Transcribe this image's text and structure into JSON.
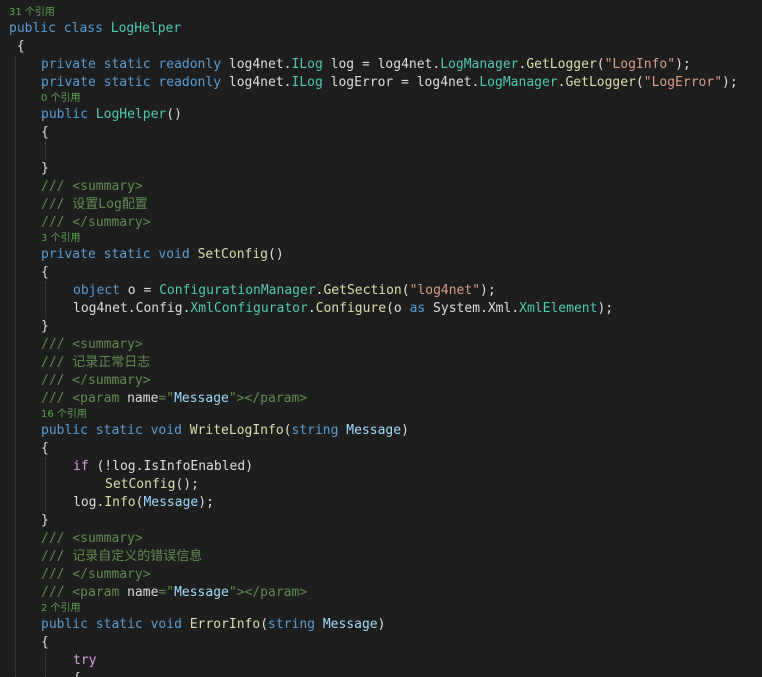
{
  "editor": {
    "colors": {
      "background": "#1e1e1e",
      "keyword": "#569cd6",
      "control_keyword": "#d8a0df",
      "type": "#4ec9b0",
      "method": "#dcdcaa",
      "string": "#d69d85",
      "comment": "#57a64a",
      "parameter": "#9cdcfe",
      "text": "#dcdcdc",
      "codelens": "#9a9a9a"
    },
    "lines": [
      {
        "kind": "lens",
        "indent": 0,
        "tokens": [
          [
            "c",
            "31 个引用"
          ]
        ]
      },
      {
        "kind": "code",
        "indent": 0,
        "tokens": [
          [
            "k",
            "public"
          ],
          [
            "p",
            " "
          ],
          [
            "k",
            "class"
          ],
          [
            "p",
            " "
          ],
          [
            "t",
            "LogHelper"
          ]
        ]
      },
      {
        "kind": "code",
        "indent": 0,
        "tokens": [
          [
            "p",
            " {"
          ]
        ]
      },
      {
        "kind": "code",
        "indent": 1,
        "tokens": [
          [
            "k",
            "private"
          ],
          [
            "p",
            " "
          ],
          [
            "k",
            "static"
          ],
          [
            "p",
            " "
          ],
          [
            "k",
            "readonly"
          ],
          [
            "p",
            " log4net."
          ],
          [
            "t",
            "ILog"
          ],
          [
            "p",
            " log = log4net."
          ],
          [
            "t",
            "LogManager"
          ],
          [
            "p",
            "."
          ],
          [
            "m",
            "GetLogger"
          ],
          [
            "p",
            "("
          ],
          [
            "s",
            "\"LogInfo\""
          ],
          [
            "p",
            ");"
          ]
        ]
      },
      {
        "kind": "code",
        "indent": 1,
        "tokens": [
          [
            "k",
            "private"
          ],
          [
            "p",
            " "
          ],
          [
            "k",
            "static"
          ],
          [
            "p",
            " "
          ],
          [
            "k",
            "readonly"
          ],
          [
            "p",
            " log4net."
          ],
          [
            "t",
            "ILog"
          ],
          [
            "p",
            " logError = log4net."
          ],
          [
            "t",
            "LogManager"
          ],
          [
            "p",
            "."
          ],
          [
            "m",
            "GetLogger"
          ],
          [
            "p",
            "("
          ],
          [
            "s",
            "\"LogError\""
          ],
          [
            "p",
            ");"
          ]
        ]
      },
      {
        "kind": "lens",
        "indent": 1,
        "tokens": [
          [
            "c",
            "0 个引用"
          ]
        ]
      },
      {
        "kind": "code",
        "indent": 1,
        "tokens": [
          [
            "k",
            "public"
          ],
          [
            "p",
            " "
          ],
          [
            "t",
            "LogHelper"
          ],
          [
            "p",
            "()"
          ]
        ]
      },
      {
        "kind": "code",
        "indent": 1,
        "tokens": [
          [
            "p",
            "{"
          ]
        ]
      },
      {
        "kind": "code",
        "indent": 1,
        "tokens": []
      },
      {
        "kind": "code",
        "indent": 1,
        "tokens": [
          [
            "p",
            "}"
          ]
        ]
      },
      {
        "kind": "code",
        "indent": 1,
        "tokens": [
          [
            "g",
            "/// <summary>"
          ]
        ]
      },
      {
        "kind": "code",
        "indent": 1,
        "tokens": [
          [
            "g",
            "/// 设置Log配置"
          ]
        ]
      },
      {
        "kind": "code",
        "indent": 1,
        "tokens": [
          [
            "g",
            "/// </summary>"
          ]
        ]
      },
      {
        "kind": "lens",
        "indent": 1,
        "tokens": [
          [
            "c",
            "3 个引用"
          ]
        ]
      },
      {
        "kind": "code",
        "indent": 1,
        "tokens": [
          [
            "k",
            "private"
          ],
          [
            "p",
            " "
          ],
          [
            "k",
            "static"
          ],
          [
            "p",
            " "
          ],
          [
            "k",
            "void"
          ],
          [
            "p",
            " "
          ],
          [
            "m",
            "SetConfig"
          ],
          [
            "p",
            "()"
          ]
        ]
      },
      {
        "kind": "code",
        "indent": 1,
        "tokens": [
          [
            "p",
            "{"
          ]
        ]
      },
      {
        "kind": "code",
        "indent": 2,
        "tokens": [
          [
            "k",
            "object"
          ],
          [
            "p",
            " o = "
          ],
          [
            "t",
            "ConfigurationManager"
          ],
          [
            "p",
            "."
          ],
          [
            "m",
            "GetSection"
          ],
          [
            "p",
            "("
          ],
          [
            "s",
            "\"log4net\""
          ],
          [
            "p",
            ");"
          ]
        ]
      },
      {
        "kind": "code",
        "indent": 2,
        "tokens": [
          [
            "p",
            "log4net.Config."
          ],
          [
            "t",
            "XmlConfigurator"
          ],
          [
            "p",
            "."
          ],
          [
            "m",
            "Configure"
          ],
          [
            "p",
            "(o "
          ],
          [
            "k",
            "as"
          ],
          [
            "p",
            " System.Xml."
          ],
          [
            "t",
            "XmlElement"
          ],
          [
            "p",
            ");"
          ]
        ]
      },
      {
        "kind": "code",
        "indent": 1,
        "tokens": [
          [
            "p",
            "}"
          ]
        ]
      },
      {
        "kind": "code",
        "indent": 1,
        "tokens": [
          [
            "g",
            "/// <summary>"
          ]
        ]
      },
      {
        "kind": "code",
        "indent": 1,
        "tokens": [
          [
            "g",
            "/// 记录正常日志"
          ]
        ]
      },
      {
        "kind": "code",
        "indent": 1,
        "tokens": [
          [
            "g",
            "/// </summary>"
          ]
        ]
      },
      {
        "kind": "code",
        "indent": 1,
        "tokens": [
          [
            "g",
            "/// <param "
          ],
          [
            "p",
            "name"
          ],
          [
            "g",
            "=\""
          ],
          [
            "a",
            "Message"
          ],
          [
            "g",
            "\"></param>"
          ]
        ]
      },
      {
        "kind": "lens",
        "indent": 1,
        "tokens": [
          [
            "c",
            "16 个引用"
          ]
        ]
      },
      {
        "kind": "code",
        "indent": 1,
        "tokens": [
          [
            "k",
            "public"
          ],
          [
            "p",
            " "
          ],
          [
            "k",
            "static"
          ],
          [
            "p",
            " "
          ],
          [
            "k",
            "void"
          ],
          [
            "p",
            " "
          ],
          [
            "m",
            "WriteLogInfo"
          ],
          [
            "p",
            "("
          ],
          [
            "k",
            "string"
          ],
          [
            "p",
            " "
          ],
          [
            "a",
            "Message"
          ],
          [
            "p",
            ")"
          ]
        ]
      },
      {
        "kind": "code",
        "indent": 1,
        "tokens": [
          [
            "p",
            "{"
          ]
        ]
      },
      {
        "kind": "code",
        "indent": 2,
        "tokens": [
          [
            "x",
            "if"
          ],
          [
            "p",
            " (!log.IsInfoEnabled)"
          ]
        ]
      },
      {
        "kind": "code",
        "indent": 3,
        "tokens": [
          [
            "m",
            "SetConfig"
          ],
          [
            "p",
            "();"
          ]
        ]
      },
      {
        "kind": "code",
        "indent": 2,
        "tokens": [
          [
            "p",
            "log."
          ],
          [
            "m",
            "Info"
          ],
          [
            "p",
            "("
          ],
          [
            "a",
            "Message"
          ],
          [
            "p",
            ");"
          ]
        ]
      },
      {
        "kind": "code",
        "indent": 1,
        "tokens": [
          [
            "p",
            "}"
          ]
        ]
      },
      {
        "kind": "code",
        "indent": 1,
        "tokens": [
          [
            "g",
            "/// <summary>"
          ]
        ]
      },
      {
        "kind": "code",
        "indent": 1,
        "tokens": [
          [
            "g",
            "/// 记录自定义的错误信息"
          ]
        ]
      },
      {
        "kind": "code",
        "indent": 1,
        "tokens": [
          [
            "g",
            "/// </summary>"
          ]
        ]
      },
      {
        "kind": "code",
        "indent": 1,
        "tokens": [
          [
            "g",
            "/// <param "
          ],
          [
            "p",
            "name"
          ],
          [
            "g",
            "=\""
          ],
          [
            "a",
            "Message"
          ],
          [
            "g",
            "\"></param>"
          ]
        ]
      },
      {
        "kind": "lens",
        "indent": 1,
        "tokens": [
          [
            "c",
            "2 个引用"
          ]
        ]
      },
      {
        "kind": "code",
        "indent": 1,
        "tokens": [
          [
            "k",
            "public"
          ],
          [
            "p",
            " "
          ],
          [
            "k",
            "static"
          ],
          [
            "p",
            " "
          ],
          [
            "k",
            "void"
          ],
          [
            "p",
            " "
          ],
          [
            "m",
            "ErrorInfo"
          ],
          [
            "p",
            "("
          ],
          [
            "k",
            "string"
          ],
          [
            "p",
            " "
          ],
          [
            "a",
            "Message"
          ],
          [
            "p",
            ")"
          ]
        ]
      },
      {
        "kind": "code",
        "indent": 1,
        "tokens": [
          [
            "p",
            "{"
          ]
        ]
      },
      {
        "kind": "code",
        "indent": 2,
        "tokens": [
          [
            "x",
            "try"
          ]
        ]
      },
      {
        "kind": "code",
        "indent": 2,
        "tokens": [
          [
            "p",
            "{"
          ]
        ]
      }
    ]
  }
}
